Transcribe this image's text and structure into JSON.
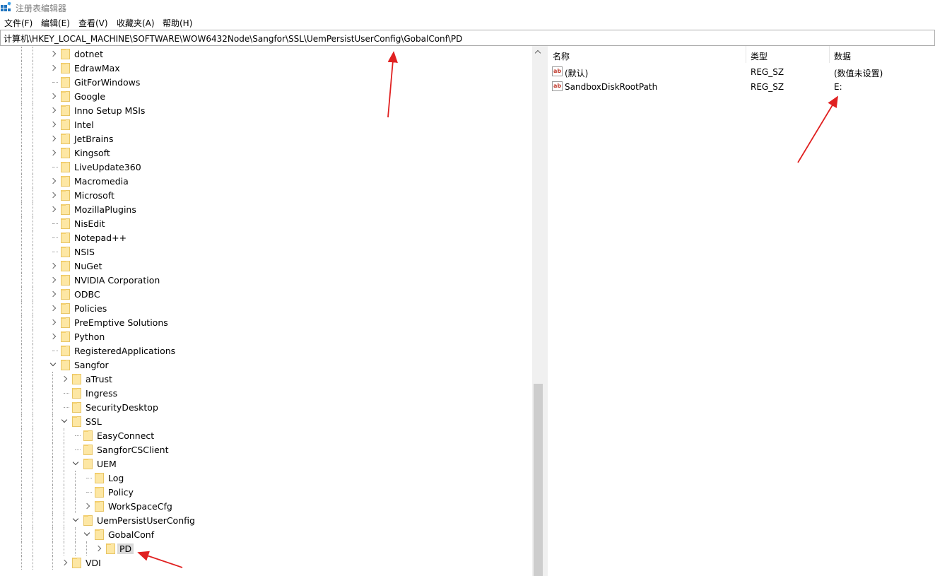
{
  "window": {
    "title": "注册表编辑器"
  },
  "menu": [
    "文件(F)",
    "编辑(E)",
    "查看(V)",
    "收藏夹(A)",
    "帮助(H)"
  ],
  "address": {
    "path": "计算机\\HKEY_LOCAL_MACHINE\\SOFTWARE\\WOW6432Node\\Sangfor\\SSL\\UemPersistUserConfig\\GobalConf\\PD"
  },
  "tree": [
    {
      "label": "dotnet",
      "level": 0,
      "toggle": "collapsed"
    },
    {
      "label": "EdrawMax",
      "level": 0,
      "toggle": "collapsed"
    },
    {
      "label": "GitForWindows",
      "level": 0,
      "toggle": "none"
    },
    {
      "label": "Google",
      "level": 0,
      "toggle": "collapsed"
    },
    {
      "label": "Inno Setup MSIs",
      "level": 0,
      "toggle": "collapsed"
    },
    {
      "label": "Intel",
      "level": 0,
      "toggle": "collapsed"
    },
    {
      "label": "JetBrains",
      "level": 0,
      "toggle": "collapsed"
    },
    {
      "label": "Kingsoft",
      "level": 0,
      "toggle": "collapsed"
    },
    {
      "label": "LiveUpdate360",
      "level": 0,
      "toggle": "none"
    },
    {
      "label": "Macromedia",
      "level": 0,
      "toggle": "collapsed"
    },
    {
      "label": "Microsoft",
      "level": 0,
      "toggle": "collapsed"
    },
    {
      "label": "MozillaPlugins",
      "level": 0,
      "toggle": "collapsed"
    },
    {
      "label": "NisEdit",
      "level": 0,
      "toggle": "none"
    },
    {
      "label": "Notepad++",
      "level": 0,
      "toggle": "none"
    },
    {
      "label": "NSIS",
      "level": 0,
      "toggle": "none"
    },
    {
      "label": "NuGet",
      "level": 0,
      "toggle": "collapsed"
    },
    {
      "label": "NVIDIA Corporation",
      "level": 0,
      "toggle": "collapsed"
    },
    {
      "label": "ODBC",
      "level": 0,
      "toggle": "collapsed"
    },
    {
      "label": "Policies",
      "level": 0,
      "toggle": "collapsed"
    },
    {
      "label": "PreEmptive Solutions",
      "level": 0,
      "toggle": "collapsed"
    },
    {
      "label": "Python",
      "level": 0,
      "toggle": "collapsed"
    },
    {
      "label": "RegisteredApplications",
      "level": 0,
      "toggle": "none"
    },
    {
      "label": "Sangfor",
      "level": 0,
      "toggle": "expanded"
    },
    {
      "label": "aTrust",
      "level": 1,
      "toggle": "collapsed"
    },
    {
      "label": "Ingress",
      "level": 1,
      "toggle": "none"
    },
    {
      "label": "SecurityDesktop",
      "level": 1,
      "toggle": "none"
    },
    {
      "label": "SSL",
      "level": 1,
      "toggle": "expanded"
    },
    {
      "label": "EasyConnect",
      "level": 2,
      "toggle": "none"
    },
    {
      "label": "SangforCSClient",
      "level": 2,
      "toggle": "none"
    },
    {
      "label": "UEM",
      "level": 2,
      "toggle": "expanded"
    },
    {
      "label": "Log",
      "level": 3,
      "toggle": "none"
    },
    {
      "label": "Policy",
      "level": 3,
      "toggle": "none"
    },
    {
      "label": "WorkSpaceCfg",
      "level": 3,
      "toggle": "collapsed"
    },
    {
      "label": "UemPersistUserConfig",
      "level": 2,
      "toggle": "expanded"
    },
    {
      "label": "GobalConf",
      "level": 3,
      "toggle": "expanded"
    },
    {
      "label": "PD",
      "level": 4,
      "toggle": "collapsed",
      "selected": true
    },
    {
      "label": "VDI",
      "level": 1,
      "toggle": "collapsed"
    }
  ],
  "list": {
    "columns": [
      "名称",
      "类型",
      "数据"
    ],
    "rows": [
      {
        "name": "(默认)",
        "type": "REG_SZ",
        "data": "(数值未设置)",
        "icon": "string-value-icon"
      },
      {
        "name": "SandboxDiskRootPath",
        "type": "REG_SZ",
        "data": "E:",
        "icon": "string-value-icon"
      }
    ]
  },
  "icon_label": "ab",
  "colors": {
    "folder": "#fde7a4",
    "selection": "#d9d9d9",
    "annotation_arrow": "#e02020",
    "title_text": "#7a7a7a"
  }
}
